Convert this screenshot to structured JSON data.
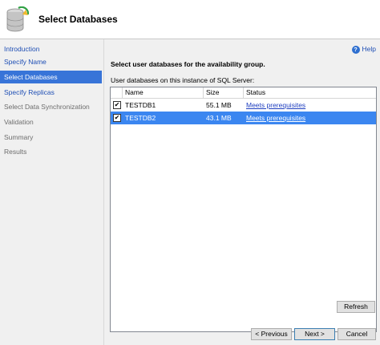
{
  "header": {
    "title": "Select Databases",
    "icon": "database-icon"
  },
  "sidebar": {
    "items": [
      {
        "label": "Introduction",
        "state": "link"
      },
      {
        "label": "Specify Name",
        "state": "link"
      },
      {
        "label": "Select Databases",
        "state": "selected"
      },
      {
        "label": "Specify Replicas",
        "state": "link"
      },
      {
        "label": "Select Data Synchronization",
        "state": "disabled"
      },
      {
        "label": "Validation",
        "state": "disabled"
      },
      {
        "label": "Summary",
        "state": "disabled"
      },
      {
        "label": "Results",
        "state": "disabled"
      }
    ]
  },
  "main": {
    "help_label": "Help",
    "instruction": "Select user databases for the availability group.",
    "grid_label": "User databases on this instance of SQL Server:",
    "columns": [
      "Name",
      "Size",
      "Status"
    ],
    "rows": [
      {
        "checked": true,
        "name": "TESTDB1",
        "size": "55.1 MB",
        "status": "Meets prerequisites",
        "selected": false
      },
      {
        "checked": true,
        "name": "TESTDB2",
        "size": "43.1 MB",
        "status": "Meets prerequisites",
        "selected": true
      }
    ],
    "refresh_label": "Refresh"
  },
  "footer": {
    "previous_label": "< Previous",
    "next_label": "Next >",
    "cancel_label": "Cancel"
  },
  "colors": {
    "nav_selected": "#3874d8",
    "row_selected": "#3b86f0",
    "link": "#1f4fb5"
  }
}
